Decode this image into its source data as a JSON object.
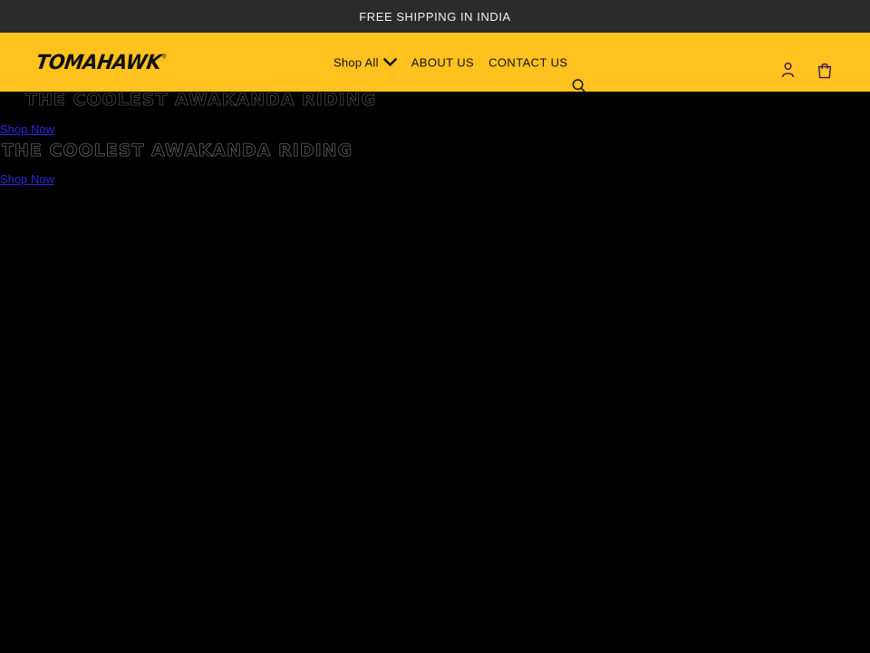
{
  "announcement": {
    "text": "FREE SHIPPING IN INDIA",
    "background": "#2b2b2b",
    "text_color": "#f2f2f2"
  },
  "header": {
    "background": "#ffc21f",
    "logo": {
      "text": "TOMAHAWK",
      "trademark": "®"
    },
    "nav": [
      {
        "label": "Shop All",
        "has_dropdown": true,
        "icon": "chevron-down-icon"
      },
      {
        "label": "ABOUT US",
        "has_dropdown": false
      },
      {
        "label": "CONTACT US",
        "has_dropdown": false
      }
    ],
    "search": {
      "icon": "search-icon",
      "label": "Search"
    },
    "icons": [
      {
        "name": "account-icon",
        "label": "Log in",
        "color": "#3b1260"
      },
      {
        "name": "cart-icon",
        "label": "Cart",
        "color": "#3b1260"
      }
    ]
  },
  "hero": {
    "background": "#000000",
    "slides": [
      {
        "heading": "THE COOLEST AWAKANDA RIDING",
        "cta_label": "Shop Now"
      },
      {
        "heading": "THE COOLEST AWAKANDA RIDING",
        "cta_label": "Shop Now"
      }
    ],
    "link_color": "#2a2ae0"
  }
}
